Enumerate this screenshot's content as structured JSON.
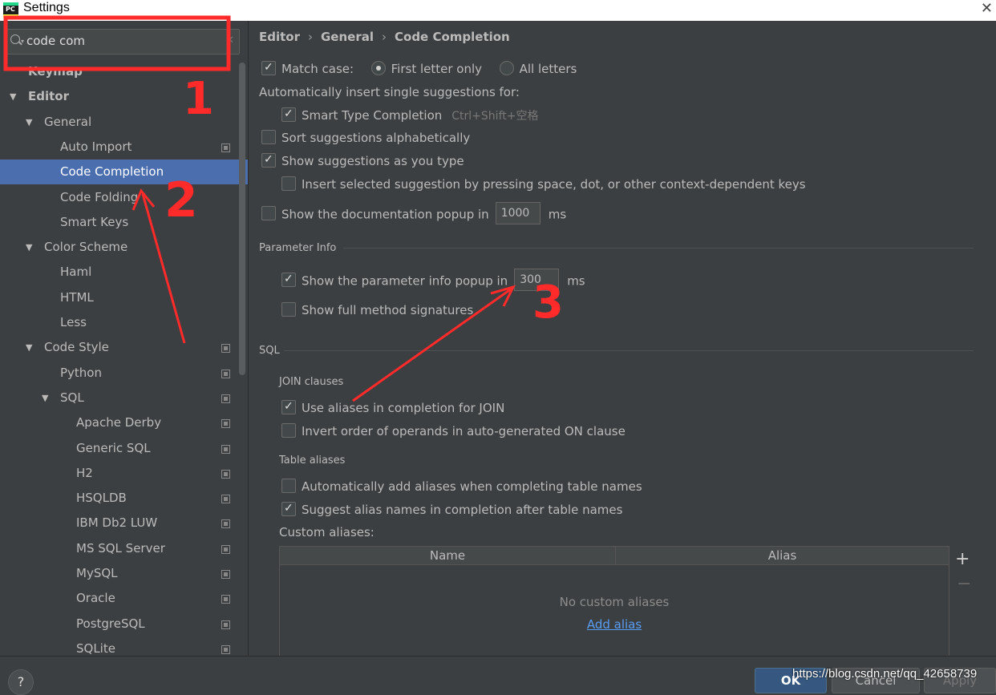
{
  "window": {
    "title": "Settings",
    "app_icon": "PC"
  },
  "search": {
    "value": "code com"
  },
  "tree": [
    {
      "label": "Keymap",
      "level": 0,
      "arrow": "",
      "proj": false,
      "selected": false
    },
    {
      "label": "Editor",
      "level": 0,
      "arrow": "▼",
      "proj": false,
      "selected": false
    },
    {
      "label": "General",
      "level": 1,
      "arrow": "▼",
      "proj": false,
      "selected": false
    },
    {
      "label": "Auto Import",
      "level": 2,
      "arrow": "",
      "proj": true,
      "selected": false
    },
    {
      "label": "Code Completion",
      "level": 2,
      "arrow": "",
      "proj": false,
      "selected": true
    },
    {
      "label": "Code Folding",
      "level": 2,
      "arrow": "",
      "proj": false,
      "selected": false
    },
    {
      "label": "Smart Keys",
      "level": 2,
      "arrow": "",
      "proj": false,
      "selected": false
    },
    {
      "label": "Color Scheme",
      "level": 1,
      "arrow": "▼",
      "proj": false,
      "selected": false
    },
    {
      "label": "Haml",
      "level": 2,
      "arrow": "",
      "proj": false,
      "selected": false
    },
    {
      "label": "HTML",
      "level": 2,
      "arrow": "",
      "proj": false,
      "selected": false
    },
    {
      "label": "Less",
      "level": 2,
      "arrow": "",
      "proj": false,
      "selected": false
    },
    {
      "label": "Code Style",
      "level": 1,
      "arrow": "▼",
      "proj": true,
      "selected": false
    },
    {
      "label": "Python",
      "level": 2,
      "arrow": "",
      "proj": true,
      "selected": false
    },
    {
      "label": "SQL",
      "level": 2,
      "arrow": "▼",
      "proj": true,
      "selected": false
    },
    {
      "label": "Apache Derby",
      "level": 3,
      "arrow": "",
      "proj": true,
      "selected": false
    },
    {
      "label": "Generic SQL",
      "level": 3,
      "arrow": "",
      "proj": true,
      "selected": false
    },
    {
      "label": "H2",
      "level": 3,
      "arrow": "",
      "proj": true,
      "selected": false
    },
    {
      "label": "HSQLDB",
      "level": 3,
      "arrow": "",
      "proj": true,
      "selected": false
    },
    {
      "label": "IBM Db2 LUW",
      "level": 3,
      "arrow": "",
      "proj": true,
      "selected": false
    },
    {
      "label": "MS SQL Server",
      "level": 3,
      "arrow": "",
      "proj": true,
      "selected": false
    },
    {
      "label": "MySQL",
      "level": 3,
      "arrow": "",
      "proj": true,
      "selected": false
    },
    {
      "label": "Oracle",
      "level": 3,
      "arrow": "",
      "proj": true,
      "selected": false
    },
    {
      "label": "PostgreSQL",
      "level": 3,
      "arrow": "",
      "proj": true,
      "selected": false
    },
    {
      "label": "SQLite",
      "level": 3,
      "arrow": "",
      "proj": true,
      "selected": false
    }
  ],
  "breadcrumb": {
    "a": "Editor",
    "b": "General",
    "c": "Code Completion",
    "sep": "›"
  },
  "options": {
    "match_case": "Match case:",
    "first_letter": "First letter only",
    "all_letters": "All letters",
    "auto_insert": "Automatically insert single suggestions for:",
    "smart_type": "Smart Type Completion",
    "smart_type_shortcut": "Ctrl+Shift+空格",
    "sort_alpha": "Sort suggestions alphabetically",
    "show_as_type": "Show suggestions as you type",
    "insert_selected": "Insert selected suggestion by pressing space, dot, or other context-dependent keys",
    "doc_popup": "Show the documentation popup in",
    "doc_popup_ms": "1000",
    "ms": "ms"
  },
  "param_info": {
    "title": "Parameter Info",
    "popup": "Show the parameter info popup in",
    "popup_ms": "300",
    "ms": "ms",
    "full_sig": "Show full method signatures"
  },
  "sql": {
    "title": "SQL",
    "join_title": "JOIN clauses",
    "use_aliases": "Use aliases in completion for JOIN",
    "invert_order": "Invert order of operands in auto-generated ON clause",
    "table_aliases_title": "Table aliases",
    "auto_add": "Automatically add aliases when completing table names",
    "suggest_alias": "Suggest alias names in completion after table names",
    "custom_aliases": "Custom aliases:",
    "col_name": "Name",
    "col_alias": "Alias",
    "empty_text": "No custom aliases",
    "add_alias": "Add alias",
    "add_btn": "+",
    "remove_btn": "−"
  },
  "buttons": {
    "help": "?",
    "ok": "OK",
    "cancel": "Cancel",
    "apply": "Apply"
  },
  "watermark": "https://blog.csdn.net/qq_42658739",
  "annotations": {
    "n1": "1",
    "n2": "2",
    "n3": "3"
  },
  "colors": {
    "selection": "#4b6eaf",
    "annotation": "#ff2a2a",
    "link": "#589df6"
  }
}
